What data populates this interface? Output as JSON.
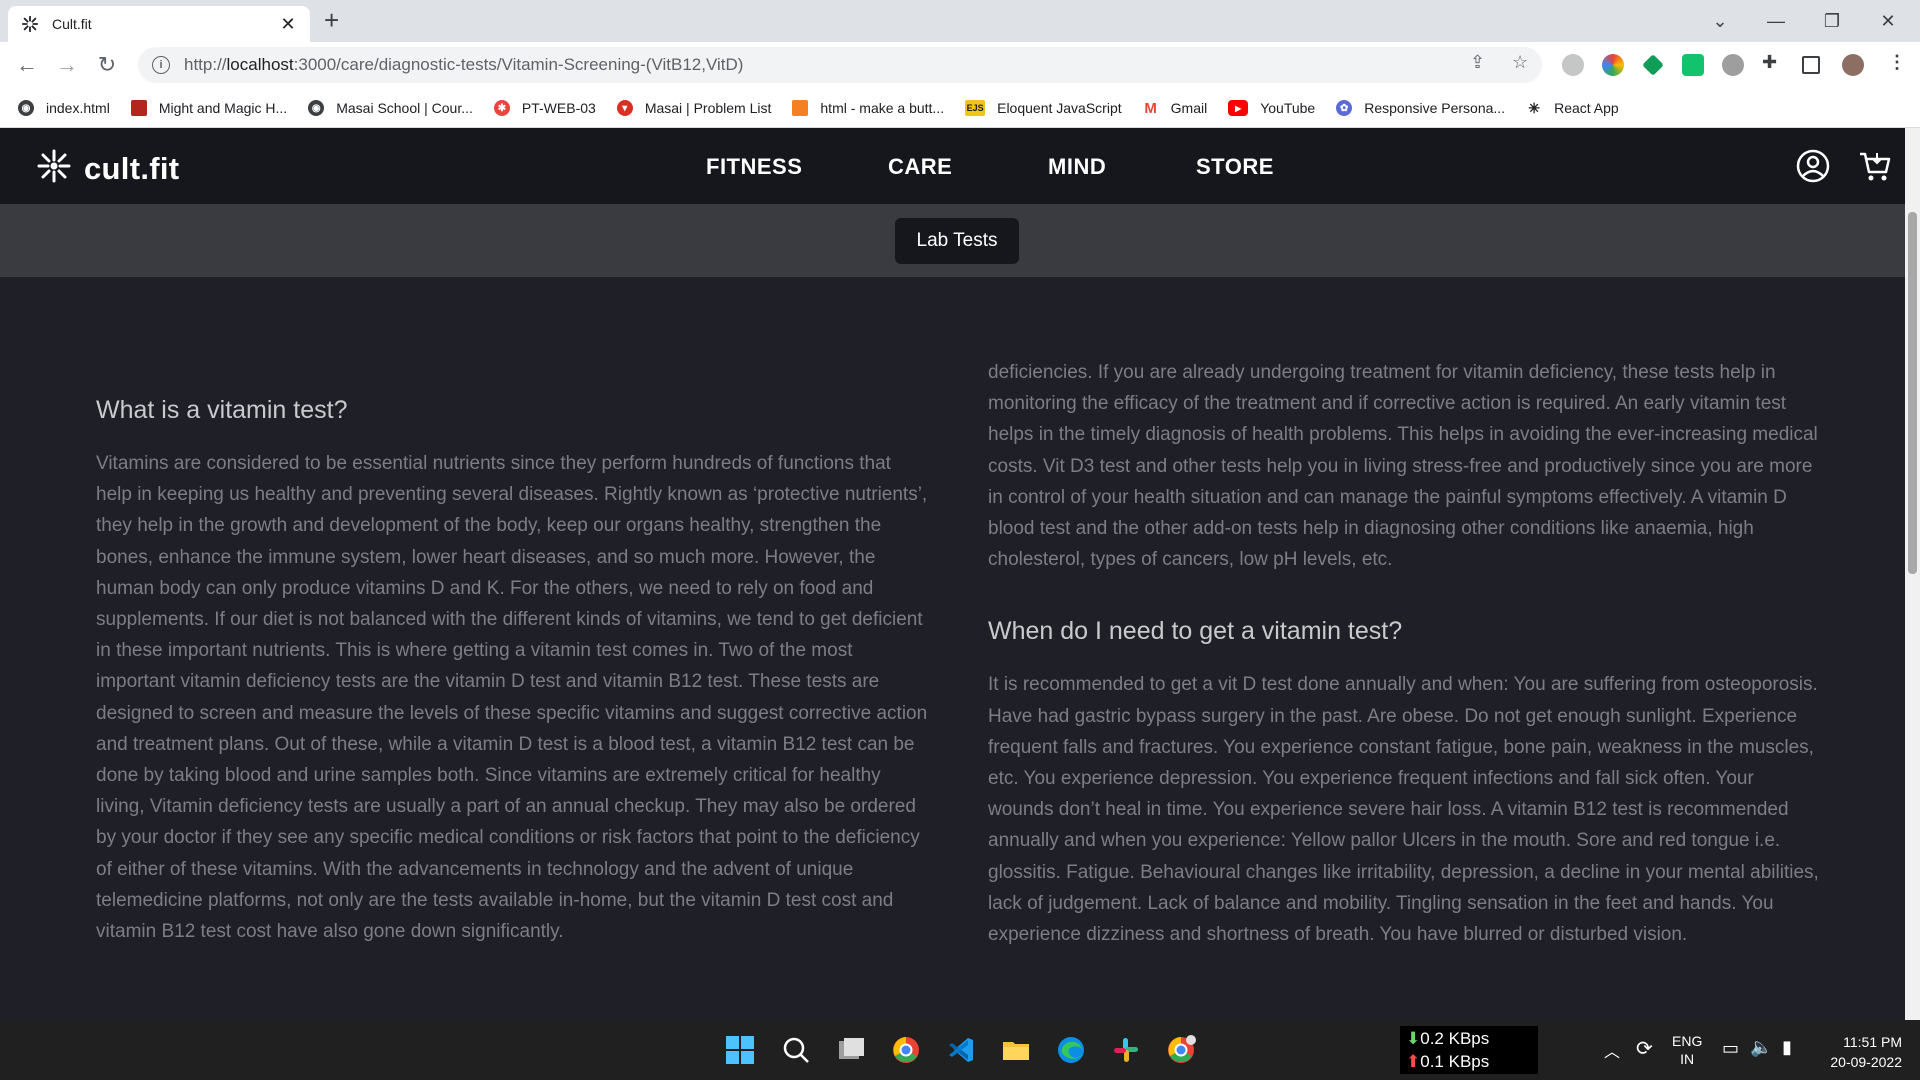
{
  "browser": {
    "tab_title": "Cult.fit",
    "url_prefix": "http://",
    "url_host": "localhost",
    "url_path": ":3000/care/diagnostic-tests/Vitamin-Screening-(VitB12,VitD)",
    "bookmarks": [
      {
        "label": "index.html",
        "color": "#202124"
      },
      {
        "label": "Might and Magic H...",
        "color": "#b3261e"
      },
      {
        "label": "Masai School | Cour...",
        "color": "#202124"
      },
      {
        "label": "PT-WEB-03",
        "color": "#e8453c"
      },
      {
        "label": "Masai | Problem List",
        "color": "#d93025"
      },
      {
        "label": "html - make a butt...",
        "color": "#f48024"
      },
      {
        "label": "Eloquent JavaScript",
        "color": "#f0c419"
      },
      {
        "label": "Gmail",
        "color": "#ea4335"
      },
      {
        "label": "YouTube",
        "color": "#ff0000"
      },
      {
        "label": "Responsive Persona...",
        "color": "#5b6bd6"
      },
      {
        "label": "React App",
        "color": "#202124"
      }
    ]
  },
  "site": {
    "logo_text": "cult.fit",
    "nav": [
      "FITNESS",
      "CARE",
      "MIND",
      "STORE"
    ],
    "sub_button": "Lab Tests"
  },
  "article": {
    "left_heading": "What is a vitamin test?",
    "left_body": "Vitamins are considered to be essential nutrients since they perform hundreds of functions that help in keeping us healthy and preventing several diseases. Rightly known as ‘protective nutrients’, they help in the growth and development of the body, keep our organs healthy, strengthen the bones, enhance the immune system, lower heart diseases, and so much more. However, the human body can only produce vitamins D and K. For the others, we need to rely on food and supplements. If our diet is not balanced with the different kinds of vitamins, we tend to get deficient in these important nutrients. This is where getting a vitamin test comes in. Two of the most important vitamin deficiency tests are the vitamin D test and vitamin B12 test. These tests are designed to screen and measure the levels of these specific vitamins and suggest corrective action and treatment plans. Out of these, while a vitamin D test is a blood test, a vitamin B12 test can be done by taking blood and urine samples both. Since vitamins are extremely critical for healthy living, Vitamin deficiency tests are usually a part of an annual checkup. They may also be ordered by your doctor if they see any specific medical conditions or risk factors that point to the deficiency of either of these vitamins. With the advancements in technology and the advent of unique telemedicine platforms, not only are the tests available in-home, but the vitamin D test cost and vitamin B12 test cost have also gone down significantly.",
    "right_top_body": "deficiencies. If you are already undergoing treatment for vitamin deficiency, these tests help in monitoring the efficacy of the treatment and if corrective action is required. An early vitamin test helps in the timely diagnosis of health problems. This helps in avoiding the ever-increasing medical costs. Vit D3 test and other tests help you in living stress-free and productively since you are more in control of your health situation and can manage the painful symptoms effectively. A vitamin D blood test and the other add-on tests help in diagnosing other conditions like anaemia, high cholesterol, types of cancers, low pH levels, etc.",
    "right_heading": "When do I need to get a vitamin test?",
    "right_body": "It is recommended to get a vit D test done annually and when: You are suffering from osteoporosis. Have had gastric bypass surgery in the past. Are obese. Do not get enough sunlight. Experience frequent falls and fractures. You experience constant fatigue, bone pain, weakness in the muscles, etc. You experience depression. You experience frequent infections and fall sick often. Your wounds don’t heal in time. You experience severe hair loss. A vitamin B12 test is recommended annually and when you experience: Yellow pallor Ulcers in the mouth. Sore and red tongue i.e. glossitis. Fatigue. Behavioural changes like irritability, depression, a decline in your mental abilities, lack of judgement. Lack of balance and mobility. Tingling sensation in the feet and hands. You experience dizziness and shortness of breath. You have blurred or disturbed vision."
  },
  "taskbar": {
    "net_down": "0.2 KBps",
    "net_up": "0.1 KBps",
    "lang_top": "ENG",
    "lang_bottom": "IN",
    "time": "11:51 PM",
    "date": "20-09-2022"
  }
}
